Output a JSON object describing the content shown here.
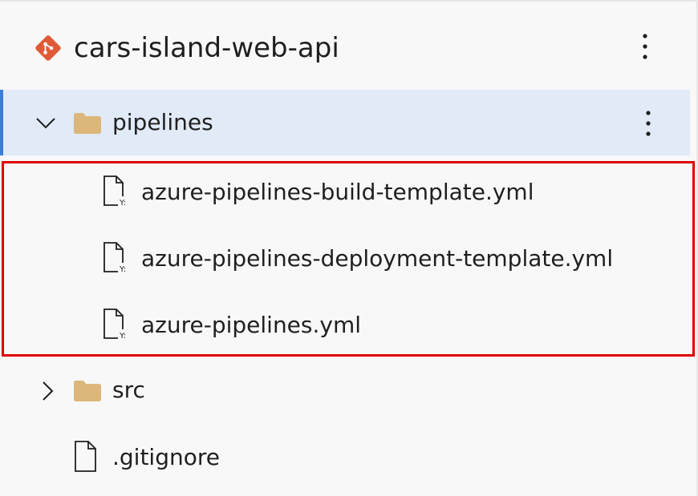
{
  "repo": {
    "name": "cars-island-web-api",
    "icon": "git-repo-icon",
    "accent_color": "#e05a37"
  },
  "tree": {
    "folders": [
      {
        "label": "pipelines",
        "expanded": true,
        "selected": true,
        "icon": "folder-icon"
      },
      {
        "label": "src",
        "expanded": false,
        "selected": false,
        "icon": "folder-icon"
      }
    ],
    "pipeline_files": [
      {
        "label": "azure-pipelines-build-template.yml",
        "icon": "yaml-file-icon"
      },
      {
        "label": "azure-pipelines-deployment-template.yml",
        "icon": "yaml-file-icon"
      },
      {
        "label": "azure-pipelines.yml",
        "icon": "yaml-file-icon"
      }
    ],
    "root_files": [
      {
        "label": ".gitignore",
        "icon": "file-icon"
      }
    ]
  },
  "colors": {
    "selection_bg": "#e1ebf8",
    "selection_bar": "#3b7dd8",
    "folder": "#dcb67a",
    "highlight": "#e00000"
  }
}
